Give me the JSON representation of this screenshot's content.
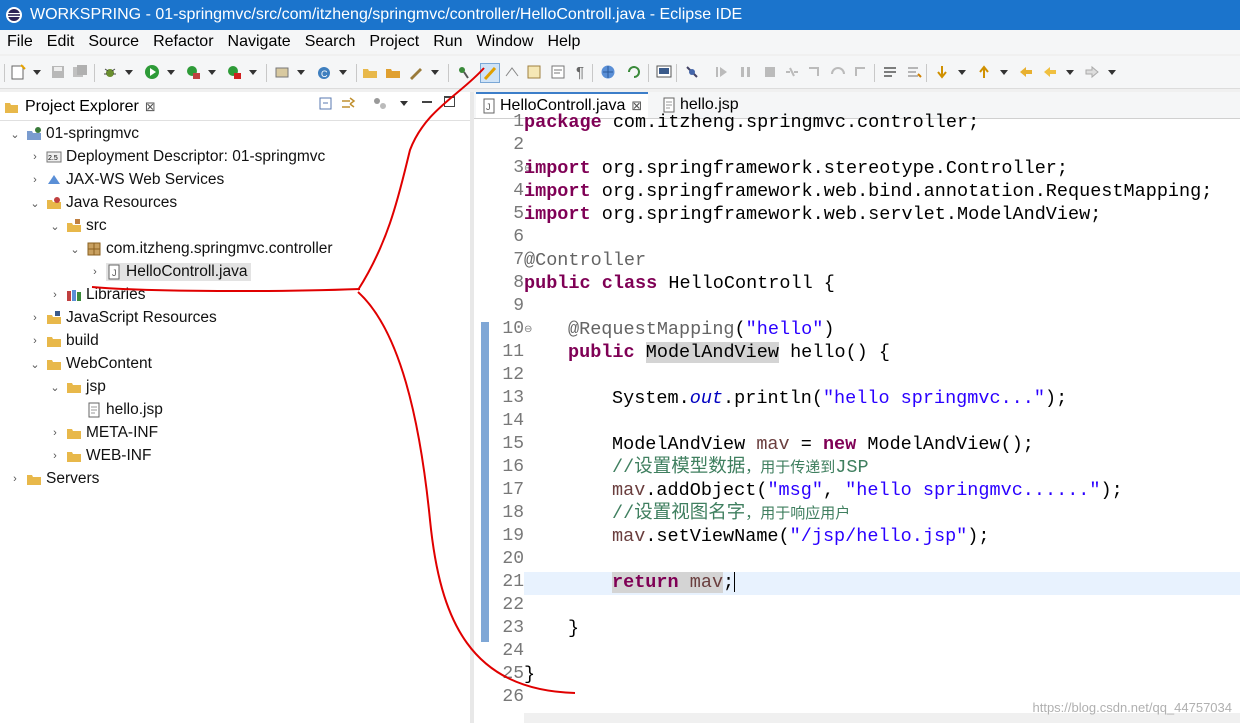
{
  "window": {
    "title": "WORKSPRING - 01-springmvc/src/com/itzheng/springmvc/controller/HelloControll.java - Eclipse IDE"
  },
  "menu": [
    "File",
    "Edit",
    "Source",
    "Refactor",
    "Navigate",
    "Search",
    "Project",
    "Run",
    "Window",
    "Help"
  ],
  "project_explorer": {
    "title": "Project Explorer",
    "close": "⊠",
    "tree": [
      {
        "label": "01-springmvc",
        "icon": "project-icon",
        "expanded": true
      },
      {
        "label": "Deployment Descriptor: 01-springmvc",
        "icon": "deployment-descriptor-icon",
        "expanded": false
      },
      {
        "label": "JAX-WS Web Services",
        "icon": "web-services-icon",
        "expanded": false
      },
      {
        "label": "Java Resources",
        "icon": "java-resources-icon",
        "expanded": true
      },
      {
        "label": "src",
        "icon": "source-folder-icon",
        "expanded": true
      },
      {
        "label": "com.itzheng.springmvc.controller",
        "icon": "package-icon",
        "expanded": true
      },
      {
        "label": "HelloControll.java",
        "icon": "java-file-icon",
        "expanded": false,
        "selected": true
      },
      {
        "label": "Libraries",
        "icon": "libraries-icon",
        "expanded": false
      },
      {
        "label": "JavaScript Resources",
        "icon": "javascript-resources-icon",
        "expanded": false
      },
      {
        "label": "build",
        "icon": "folder-icon",
        "expanded": false
      },
      {
        "label": "WebContent",
        "icon": "folder-icon",
        "expanded": true
      },
      {
        "label": "jsp",
        "icon": "folder-icon",
        "expanded": true
      },
      {
        "label": "hello.jsp",
        "icon": "jsp-file-icon"
      },
      {
        "label": "META-INF",
        "icon": "folder-icon",
        "expanded": false
      },
      {
        "label": "WEB-INF",
        "icon": "folder-icon",
        "expanded": false
      },
      {
        "label": "Servers",
        "icon": "servers-icon",
        "expanded": false
      }
    ]
  },
  "editor": {
    "tabs": [
      {
        "label": "HelloControll.java",
        "close": "⊠",
        "active": true
      },
      {
        "label": "hello.jsp",
        "active": false
      }
    ],
    "line_numbers": [
      "1",
      "2",
      "3",
      "4",
      "5",
      "6",
      "7",
      "8",
      "9",
      "10",
      "11",
      "12",
      "13",
      "14",
      "15",
      "16",
      "17",
      "18",
      "19",
      "20",
      "21",
      "22",
      "23",
      "24",
      "25",
      "26"
    ],
    "lines": {
      "l1_kw": "package",
      "l1_rest": " com.itzheng.springmvc.controller;",
      "l3_kw": "import",
      "l3_rest": " org.springframework.stereotype.Controller;",
      "l4_kw": "import",
      "l4_rest": " org.springframework.web.bind.annotation.RequestMapping;",
      "l5_kw": "import",
      "l5_rest": " org.springframework.web.servlet.ModelAndView;",
      "l7_ann": "@Controller",
      "l8_kw1": "public",
      "l8_kw2": "class",
      "l8_rest": " HelloControll {",
      "l10_ann": "@RequestMapping",
      "l10_p1": "(",
      "l10_str": "\"hello\"",
      "l10_p2": ")",
      "l11_kw": "public",
      "l11_type": "ModelAndView",
      "l11_rest": " hello() {",
      "l13_a": "System.",
      "l13_fld": "out",
      "l13_b": ".println(",
      "l13_str": "\"hello springmvc...\"",
      "l13_c": ");",
      "l15_a": "ModelAndView ",
      "l15_var": "mav",
      "l15_b": " = ",
      "l15_kw": "new",
      "l15_c": " ModelAndView();",
      "l16_a": "//设置模型数据",
      "l16_b": "，用于传递到",
      "l16_c": "JSP",
      "l17_var": "mav",
      "l17_a": ".addObject(",
      "l17_s1": "\"msg\"",
      "l17_b": ", ",
      "l17_s2": "\"hello springmvc......\"",
      "l17_c": ");",
      "l18_a": "//设置视图名字",
      "l18_b": "，用于响应用户",
      "l19_var": "mav",
      "l19_a": ".setViewName(",
      "l19_str": "\"/jsp/hello.jsp\"",
      "l19_b": ");",
      "l21_kw": "return",
      "l21_sp": " ",
      "l21_var": "mav",
      "l21_semi": ";",
      "l23": "}",
      "l25": "}"
    },
    "watermark": "https://blog.csdn.net/qq_44757034"
  },
  "colors": {
    "titlebar": "#1b74cc",
    "keyword": "#7f0055",
    "string": "#2a00ff",
    "annotation_red": "#e00000"
  }
}
